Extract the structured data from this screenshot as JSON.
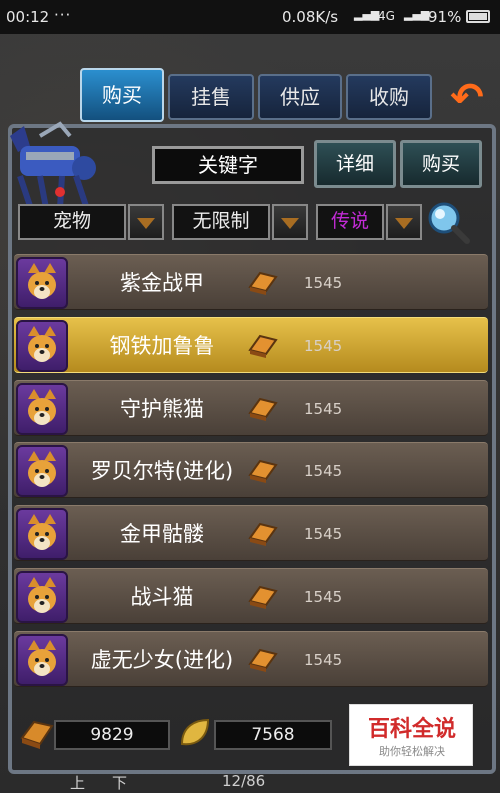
{
  "status_bar": {
    "time": "00:12",
    "dots": "···",
    "speed": "0.08K/s",
    "network": "4G",
    "battery": "91%"
  },
  "tabs": [
    {
      "label": "购买",
      "active": true
    },
    {
      "label": "挂售",
      "active": false
    },
    {
      "label": "供应",
      "active": false
    },
    {
      "label": "收购",
      "active": false
    }
  ],
  "search_bar": {
    "keyword_label": "关键字",
    "detail_button": "详细",
    "buy_button": "购买"
  },
  "filters": {
    "category": "宠物",
    "level": "无限制",
    "rarity": "传说",
    "rarity_color": "#c22bd6"
  },
  "items": [
    {
      "name": "紫金战甲",
      "price": "1545",
      "selected": false
    },
    {
      "name": "钢铁加鲁鲁",
      "price": "1545",
      "selected": true
    },
    {
      "name": "守护熊猫",
      "price": "1545",
      "selected": false
    },
    {
      "name": "罗贝尔特(进化)",
      "price": "1545",
      "selected": false
    },
    {
      "name": "金甲骷髅",
      "price": "1545",
      "selected": false
    },
    {
      "name": "战斗猫",
      "price": "1545",
      "selected": false
    },
    {
      "name": "虚无少女(进化)",
      "price": "1545",
      "selected": false
    }
  ],
  "currency": {
    "gold": "9829",
    "leaf": "7568"
  },
  "watermark": {
    "title": "百科全说",
    "subtitle": "助你轻松解决"
  },
  "footer": {
    "left": "上",
    "mid": "下",
    "page": "12/86"
  },
  "colors": {
    "accent_tab": "#2b8fcf",
    "selected_row": "#e6c14a",
    "back_arrow": "#ff6b1a"
  }
}
